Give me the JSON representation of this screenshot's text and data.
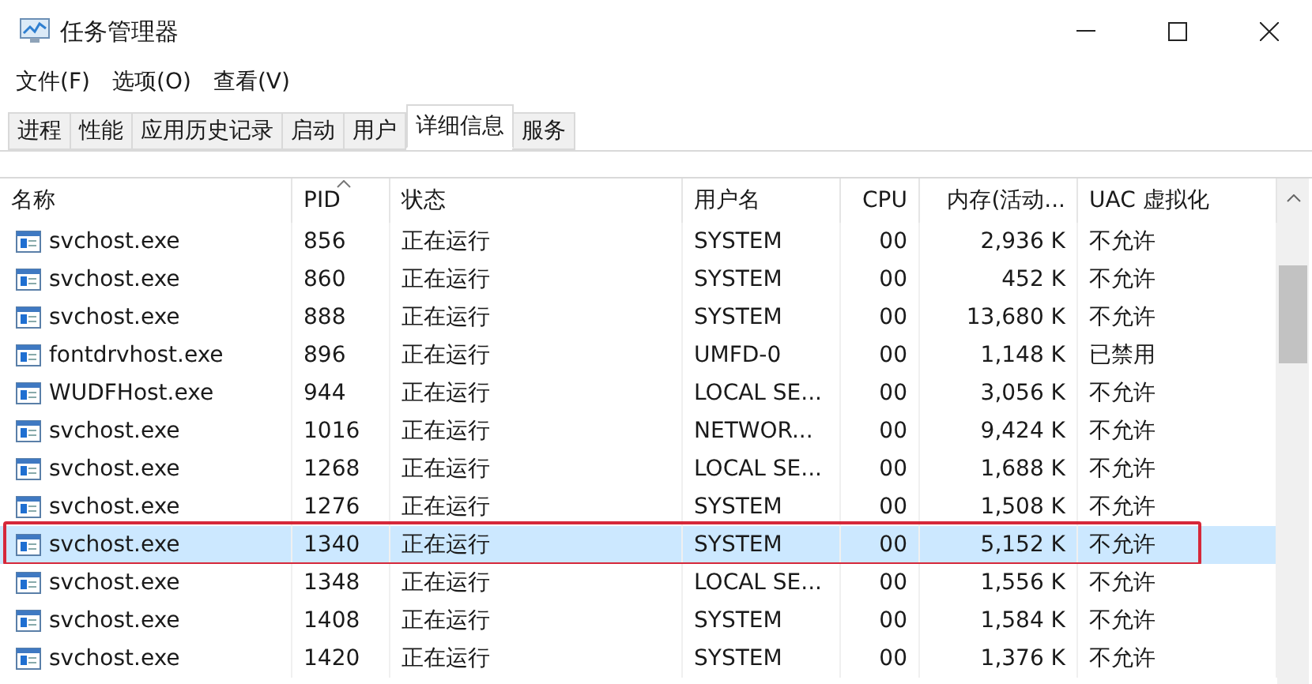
{
  "window": {
    "title": "任务管理器"
  },
  "menu": [
    "文件(F)",
    "选项(O)",
    "查看(V)"
  ],
  "tabs": [
    {
      "label": "进程",
      "selected": false
    },
    {
      "label": "性能",
      "selected": false
    },
    {
      "label": "应用历史记录",
      "selected": false
    },
    {
      "label": "启动",
      "selected": false
    },
    {
      "label": "用户",
      "selected": false
    },
    {
      "label": "详细信息",
      "selected": true
    },
    {
      "label": "服务",
      "selected": false
    }
  ],
  "table": {
    "columns": [
      {
        "label": "名称",
        "sorted": false
      },
      {
        "label": "PID",
        "sorted": true
      },
      {
        "label": "状态",
        "sorted": false
      },
      {
        "label": "用户名",
        "sorted": false
      },
      {
        "label": "CPU",
        "sorted": false
      },
      {
        "label": "内存(活动...",
        "sorted": false
      },
      {
        "label": "UAC 虚拟化",
        "sorted": false
      }
    ],
    "rows": [
      {
        "cells": [
          "svchost.exe",
          "856",
          "正在运行",
          "SYSTEM",
          "00",
          "2,936 K",
          "不允许"
        ],
        "selected": false,
        "outlined": false
      },
      {
        "cells": [
          "svchost.exe",
          "860",
          "正在运行",
          "SYSTEM",
          "00",
          "452 K",
          "不允许"
        ],
        "selected": false,
        "outlined": false
      },
      {
        "cells": [
          "svchost.exe",
          "888",
          "正在运行",
          "SYSTEM",
          "00",
          "13,680 K",
          "不允许"
        ],
        "selected": false,
        "outlined": false
      },
      {
        "cells": [
          "fontdrvhost.exe",
          "896",
          "正在运行",
          "UMFD-0",
          "00",
          "1,148 K",
          "已禁用"
        ],
        "selected": false,
        "outlined": false
      },
      {
        "cells": [
          "WUDFHost.exe",
          "944",
          "正在运行",
          "LOCAL SE...",
          "00",
          "3,056 K",
          "不允许"
        ],
        "selected": false,
        "outlined": false
      },
      {
        "cells": [
          "svchost.exe",
          "1016",
          "正在运行",
          "NETWOR...",
          "00",
          "9,424 K",
          "不允许"
        ],
        "selected": false,
        "outlined": false
      },
      {
        "cells": [
          "svchost.exe",
          "1268",
          "正在运行",
          "LOCAL SE...",
          "00",
          "1,688 K",
          "不允许"
        ],
        "selected": false,
        "outlined": false
      },
      {
        "cells": [
          "svchost.exe",
          "1276",
          "正在运行",
          "SYSTEM",
          "00",
          "1,508 K",
          "不允许"
        ],
        "selected": false,
        "outlined": false
      },
      {
        "cells": [
          "svchost.exe",
          "1340",
          "正在运行",
          "SYSTEM",
          "00",
          "5,152 K",
          "不允许"
        ],
        "selected": true,
        "outlined": true
      },
      {
        "cells": [
          "svchost.exe",
          "1348",
          "正在运行",
          "LOCAL SE...",
          "00",
          "1,556 K",
          "不允许"
        ],
        "selected": false,
        "outlined": false
      },
      {
        "cells": [
          "svchost.exe",
          "1408",
          "正在运行",
          "SYSTEM",
          "00",
          "1,584 K",
          "不允许"
        ],
        "selected": false,
        "outlined": false
      },
      {
        "cells": [
          "svchost.exe",
          "1420",
          "正在运行",
          "SYSTEM",
          "00",
          "1,376 K",
          "不允许"
        ],
        "selected": false,
        "outlined": false
      }
    ]
  }
}
